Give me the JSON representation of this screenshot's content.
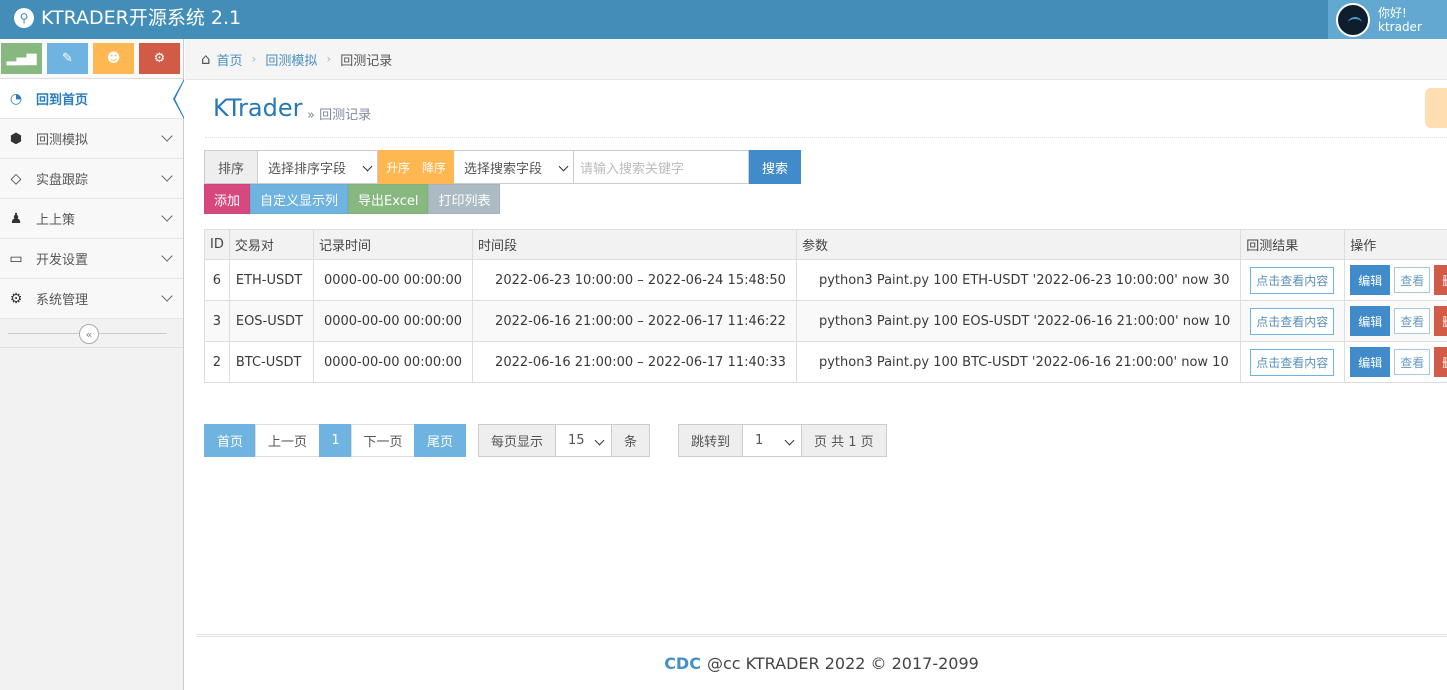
{
  "navbar": {
    "brand": "KTRADER开源系统 2.1",
    "greeting": "你好!",
    "username": "ktrader"
  },
  "sidebar": {
    "items": [
      {
        "label": "回到首页",
        "icon": "tachometer-icon",
        "glyph": "◔"
      },
      {
        "label": "回测模拟",
        "icon": "cube-icon",
        "glyph": "⬢"
      },
      {
        "label": "实盘跟踪",
        "icon": "diamond-icon",
        "glyph": "◇"
      },
      {
        "label": "上上策",
        "icon": "android-icon",
        "glyph": "♟"
      },
      {
        "label": "开发设置",
        "icon": "desktop-icon",
        "glyph": "▭"
      },
      {
        "label": "系统管理",
        "icon": "gear-icon",
        "glyph": "⚙"
      }
    ],
    "collapse_glyph": "«"
  },
  "breadcrumb": {
    "home": "首页",
    "parent": "回测模拟",
    "current": "回测记录"
  },
  "page": {
    "title": "KTrader",
    "subtitle": "回测记录"
  },
  "toolbar": {
    "sort_label": "排序",
    "sort_select": "选择排序字段",
    "asc": "升序",
    "desc": "降序",
    "search_select": "选择搜索字段",
    "search_placeholder": "请输入搜索关键字",
    "search_button": "搜索"
  },
  "actions": {
    "add": "添加",
    "custom_columns": "自定义显示列",
    "export_excel": "导出Excel",
    "print_list": "打印列表"
  },
  "table": {
    "headers": [
      "ID",
      "交易对",
      "记录时间",
      "时间段",
      "参数",
      "回测结果",
      "操作"
    ],
    "rows": [
      {
        "id": "6",
        "pair": "ETH-USDT",
        "record_time": "0000-00-00 00:00:00",
        "period": "2022-06-23 10:00:00 – 2022-06-24 15:48:50",
        "params": "python3 Paint.py 100 ETH-USDT '2022-06-23 10:00:00' now 30",
        "result": "点击查看内容"
      },
      {
        "id": "3",
        "pair": "EOS-USDT",
        "record_time": "0000-00-00 00:00:00",
        "period": "2022-06-16 21:00:00 – 2022-06-17 11:46:22",
        "params": "python3 Paint.py 100 EOS-USDT '2022-06-16 21:00:00' now 10",
        "result": "点击查看内容"
      },
      {
        "id": "2",
        "pair": "BTC-USDT",
        "record_time": "0000-00-00 00:00:00",
        "period": "2022-06-16 21:00:00 – 2022-06-17 11:40:33",
        "params": "python3 Paint.py 100 BTC-USDT '2022-06-16 21:00:00' now 10",
        "result": "点击查看内容"
      }
    ],
    "edit": "编辑",
    "view": "查看",
    "delete": "删除"
  },
  "pagination": {
    "first": "首页",
    "prev": "上一页",
    "current": "1",
    "next": "下一页",
    "last": "尾页",
    "per_page_label": "每页显示",
    "per_page_value": "15",
    "per_page_unit": "条",
    "jump_label": "跳转到",
    "jump_value": "1",
    "page_suffix": "页  共 1 页"
  },
  "footer": {
    "brand": "CDC",
    "text": "@cc KTRADER 2022 © 2017-2099"
  },
  "colors": {
    "navbar": "#438eb9",
    "accent": "#2679b5",
    "danger": "#d15b47"
  }
}
